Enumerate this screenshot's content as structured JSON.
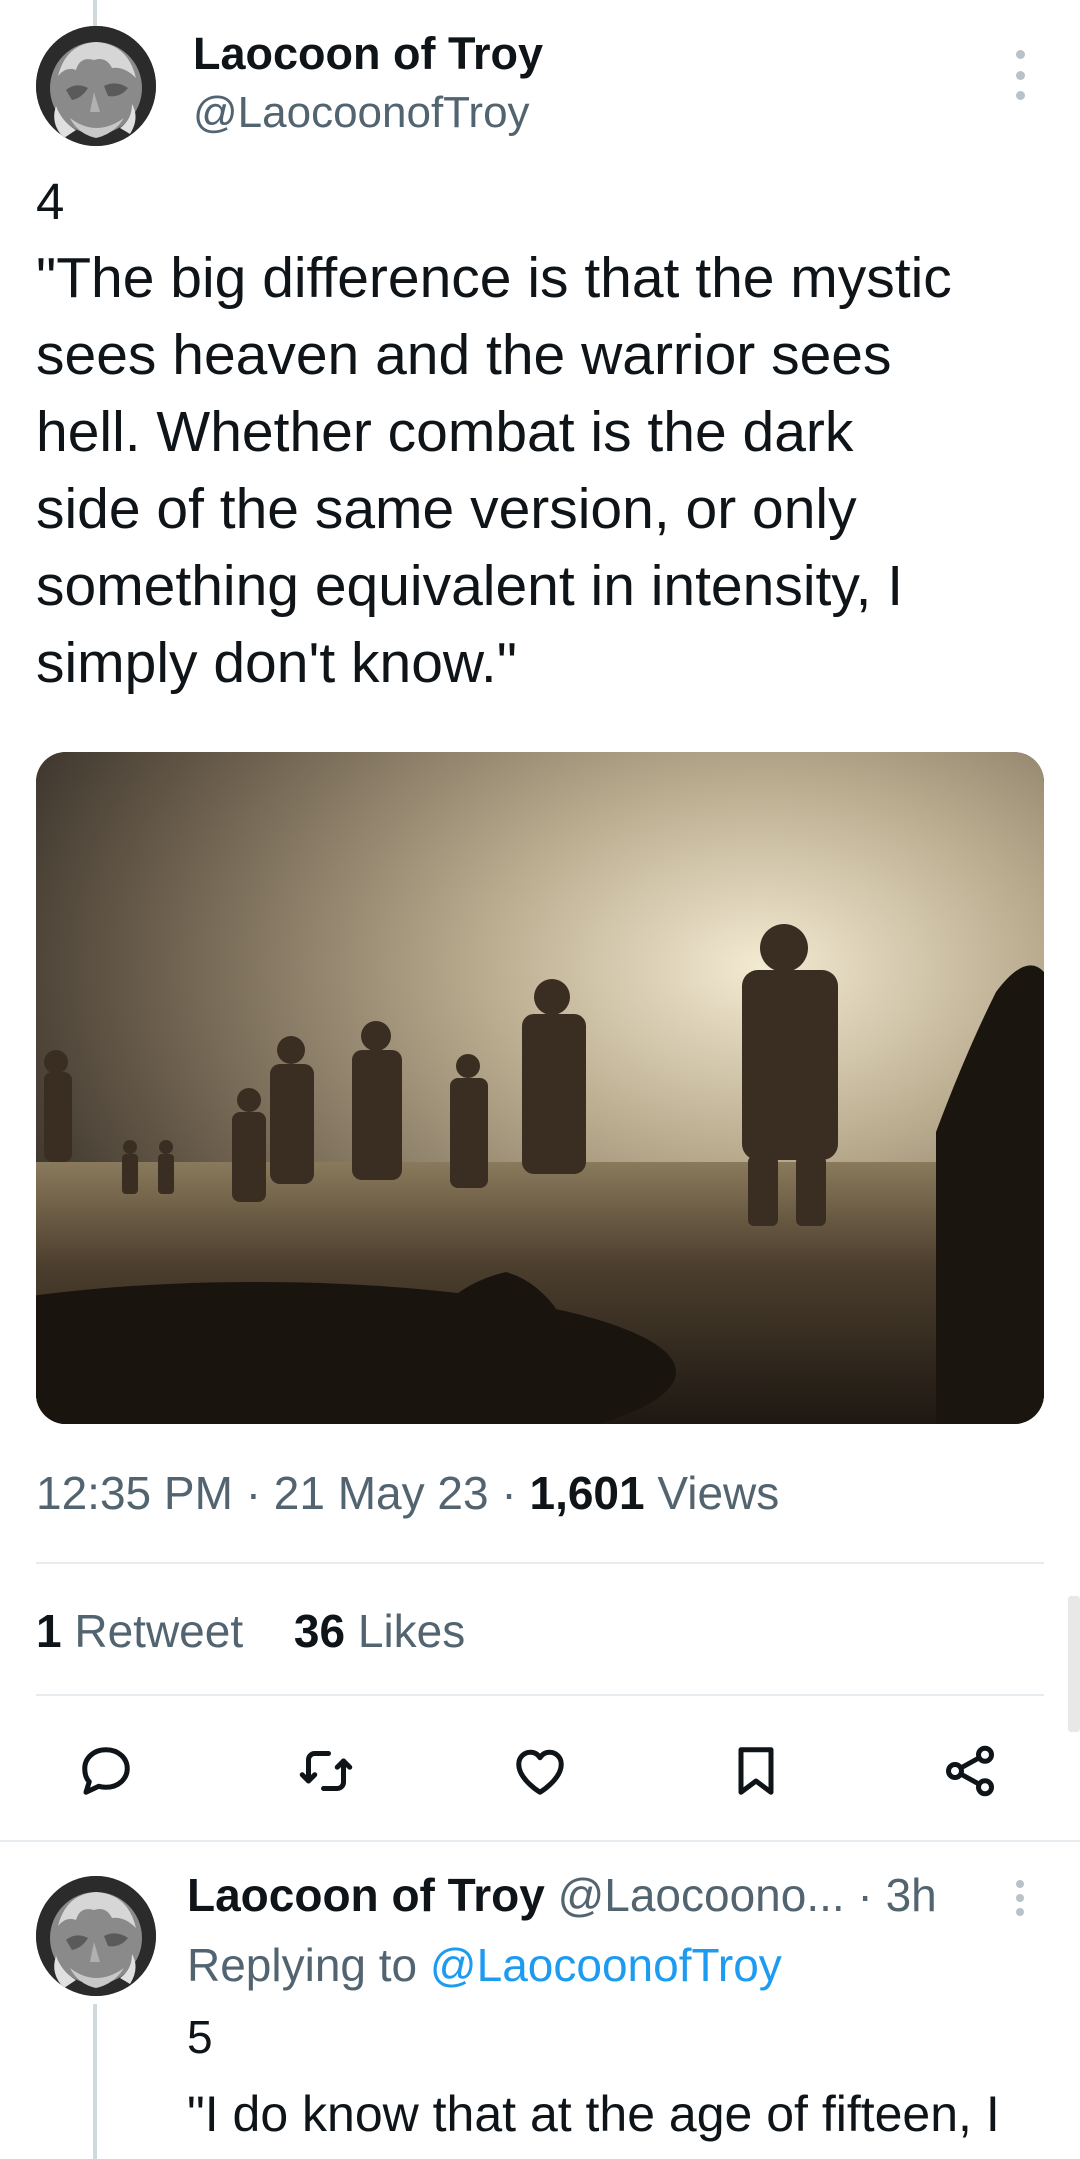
{
  "main_tweet": {
    "author_name": "Laocoon of Troy",
    "author_handle": "@LaocoonofTroy",
    "number": "4",
    "text": "\"The big difference is that the mystic\nsees heaven and the warrior sees\nhell. Whether combat is the dark\nside of the same version, or only\nsomething equivalent in intensity, I\nsimply don't know.\"",
    "time": "12:35 PM",
    "separator": "·",
    "date": "21 May 23",
    "views_count": "1,601",
    "views_label": "Views",
    "retweets_count": "1",
    "retweets_label": "Retweet",
    "likes_count": "36",
    "likes_label": "Likes"
  },
  "actions": {
    "reply_icon": "speech-bubble-icon",
    "retweet_icon": "retweet-icon",
    "like_icon": "heart-icon",
    "bookmark_icon": "bookmark-icon",
    "share_icon": "share-icon"
  },
  "reply_tweet": {
    "author_name": "Laocoon of Troy",
    "author_handle": "@Laocoono...",
    "separator": "·",
    "time_ago": "3h",
    "replying_label": "Replying to",
    "replying_handle": "@LaocoonofTroy",
    "number": "5",
    "text": "\"I do know that at the age of fifteen, I"
  },
  "colors": {
    "text_primary": "#0f1419",
    "text_secondary": "#536471",
    "link": "#1d9bf0",
    "divider": "#e6ecf0"
  }
}
